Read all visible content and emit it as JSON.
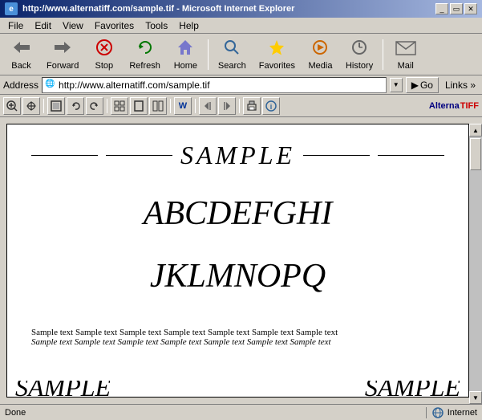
{
  "titleBar": {
    "title": "http://www.alternatiff.com/sample.tif - Microsoft Internet Explorer",
    "icon": "IE"
  },
  "menuBar": {
    "items": [
      "File",
      "Edit",
      "View",
      "Favorites",
      "Tools",
      "Help"
    ]
  },
  "toolbar": {
    "buttons": [
      {
        "id": "back",
        "label": "Back",
        "icon": "◀",
        "disabled": false
      },
      {
        "id": "forward",
        "label": "Forward",
        "icon": "▶",
        "disabled": false
      },
      {
        "id": "stop",
        "label": "Stop",
        "icon": "✕",
        "disabled": false
      },
      {
        "id": "refresh",
        "label": "Refresh",
        "icon": "↻",
        "disabled": false
      },
      {
        "id": "home",
        "label": "Home",
        "icon": "⌂",
        "disabled": false
      },
      {
        "id": "search",
        "label": "Search",
        "icon": "🔍",
        "disabled": false
      },
      {
        "id": "favorites",
        "label": "Favorites",
        "icon": "★",
        "disabled": false
      },
      {
        "id": "media",
        "label": "Media",
        "icon": "♪",
        "disabled": false
      },
      {
        "id": "history",
        "label": "History",
        "icon": "🕐",
        "disabled": false
      },
      {
        "id": "mail",
        "label": "Mail",
        "icon": "✉",
        "disabled": false
      }
    ]
  },
  "addressBar": {
    "label": "Address",
    "value": "http://www.alternatiff.com/sample.tif",
    "goLabel": "Go",
    "linksLabel": "Links »"
  },
  "pluginToolbar": {
    "buttons": [
      "🔍",
      "✋",
      "▦",
      "↩",
      "↪",
      "▣",
      "◻",
      "▤",
      "▥",
      "W",
      "◀",
      "▶",
      "▦",
      "?"
    ],
    "logoAlt": "Alterna",
    "logoTiff": "TIFF"
  },
  "document": {
    "title": "SAMPLE",
    "row1": "ABCDEFGHI",
    "row2": "JKLMNOPQ",
    "sampleText": "Sample text Sample text Sample text Sample text Sample text Sample text Sample text",
    "sampleTextItalic": "Sample text Sample text Sample text Sample text Sample text Sample text Sample text",
    "bottomText1": "SAMPLE",
    "bottomText2": "SAMPLE"
  },
  "statusBar": {
    "status": "Done",
    "zone": "Internet"
  }
}
